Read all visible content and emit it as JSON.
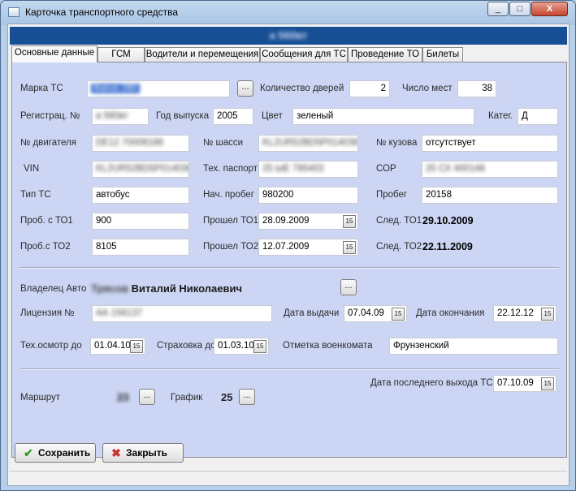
{
  "window": {
    "title": "Карточка транспортного средства",
    "header_text": "а 560вт"
  },
  "window_buttons": {
    "minimize": "_",
    "maximize": "□",
    "close": "X"
  },
  "tabs": [
    "Основные данные",
    "ГСМ",
    "Водители и перемещения",
    "Сообщения для ТС",
    "Проведение ТО",
    "Билеты"
  ],
  "fields": {
    "marka_label": "Марка ТС",
    "marka_value": "Ikarus 280",
    "doors_label": "Количество дверей",
    "doors_value": "2",
    "seats_label": "Число мест",
    "seats_value": "38",
    "reg_label": "Регистрац. №",
    "reg_value": "а 560вт",
    "year_label": "Год выпуска",
    "year_value": "2005",
    "color_label": "Цвет",
    "color_value": "зеленый",
    "categ_label": "Катег.",
    "categ_value": "Д",
    "engine_label": "№ двигателя",
    "engine_value": "DE12 70008186",
    "chassis_label": "№ шасси",
    "chassis_value": "KL2UR52BD5P014038",
    "body_label": "№ кузова",
    "body_value": "отсутствует",
    "vin_label": "VIN",
    "vin_value": "KL2UR52BD5P014038",
    "passport_label": "Тех. паспорт",
    "passport_value": "25 ЫЕ 795403",
    "cor_label": "СОР",
    "cor_value": "25 СХ 400148",
    "type_label": "Тип ТС",
    "type_value": "автобус",
    "start_mileage_label": "Нач. пробег",
    "start_mileage_value": "980200",
    "mileage_label": "Пробег",
    "mileage_value": "20158",
    "to1_mileage_label": "Проб. с ТО1",
    "to1_mileage_value": "900",
    "to1_done_label": "Прошел ТО1",
    "to1_done_value": "28.09.2009",
    "to1_next_label": "След. ТО1",
    "to1_next_value": "29.10.2009",
    "to2_mileage_label": "Проб.с ТО2",
    "to2_mileage_value": "8105",
    "to2_done_label": "Прошел ТО2",
    "to2_done_value": "12.07.2009",
    "to2_next_label": "След. ТО2",
    "to2_next_value": "22.11.2009"
  },
  "owner": {
    "label": "Владелец Авто",
    "surname": "Трясов",
    "name": "Виталий Николаевич"
  },
  "license": {
    "label": "Лицензия №",
    "value": "АА 156137",
    "issue_label": "Дата выдачи",
    "issue_value": "07.04.09",
    "end_label": "Дата окончания",
    "end_value": "22.12.12"
  },
  "inspection": {
    "tech_label": "Тех.осмотр до",
    "tech_value": "01.04.10",
    "insurance_label": "Страховка до",
    "insurance_value": "01.03.10",
    "military_label": "Отметка военкомата",
    "military_value": "Фрунзенский"
  },
  "route": {
    "last_exit_label": "Дата последнего выхода ТС",
    "last_exit_value": "07.10.09",
    "route_label": "Маршрут",
    "route_value": "23",
    "schedule_label": "График",
    "schedule_value": "25"
  },
  "buttons": {
    "browse": "...",
    "calendar": "15",
    "save": "Сохранить",
    "close": "Закрыть"
  },
  "icons": {
    "save": "checkmark-icon",
    "close": "cross-icon",
    "calendar": "calendar-icon"
  },
  "colors": {
    "panel_bg": "#ccd6f4",
    "header_band": "#174f94",
    "save_icon": "#2e9b2e",
    "close_icon": "#c8302a"
  }
}
